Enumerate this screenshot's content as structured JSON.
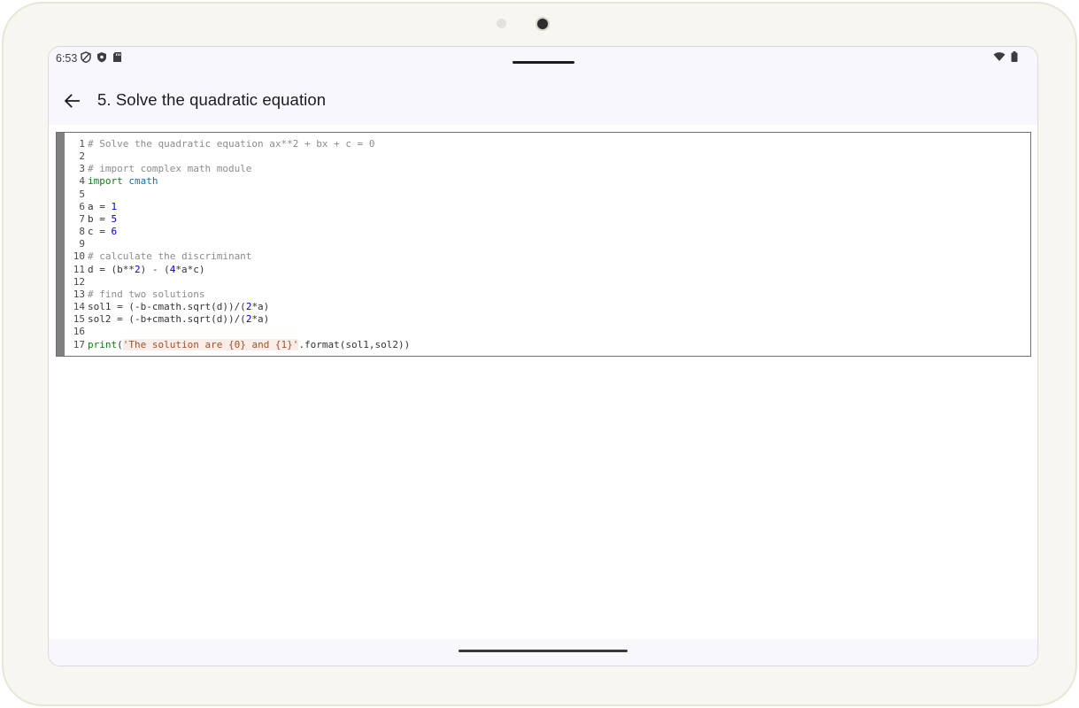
{
  "status_bar": {
    "time": "6:53",
    "left_icons": [
      "vpn-shield-icon",
      "privacy-shield-icon",
      "sd-card-icon"
    ],
    "right_icons": [
      "wifi-icon",
      "battery-icon"
    ]
  },
  "app_bar": {
    "back_icon": "arrow-left-icon",
    "title": "5. Solve the quadratic equation"
  },
  "code": {
    "lines": [
      {
        "n": "1",
        "tokens": [
          {
            "t": "# Solve the quadratic equation ax**2 + bx + c = 0",
            "c": "cm"
          }
        ]
      },
      {
        "n": "2",
        "tokens": []
      },
      {
        "n": "3",
        "tokens": [
          {
            "t": "# import complex math module",
            "c": "cm"
          }
        ]
      },
      {
        "n": "4",
        "tokens": [
          {
            "t": "import",
            "c": "kw"
          },
          {
            "t": " ",
            "c": ""
          },
          {
            "t": "cmath",
            "c": "fn"
          }
        ]
      },
      {
        "n": "5",
        "tokens": []
      },
      {
        "n": "6",
        "tokens": [
          {
            "t": "a = ",
            "c": ""
          },
          {
            "t": "1",
            "c": "num"
          }
        ]
      },
      {
        "n": "7",
        "tokens": [
          {
            "t": "b = ",
            "c": ""
          },
          {
            "t": "5",
            "c": "num"
          }
        ]
      },
      {
        "n": "8",
        "tokens": [
          {
            "t": "c = ",
            "c": ""
          },
          {
            "t": "6",
            "c": "num"
          }
        ]
      },
      {
        "n": "9",
        "tokens": []
      },
      {
        "n": "10",
        "tokens": [
          {
            "t": "# calculate the discriminant",
            "c": "cm"
          }
        ]
      },
      {
        "n": "11",
        "tokens": [
          {
            "t": "d = (b**",
            "c": ""
          },
          {
            "t": "2",
            "c": "num"
          },
          {
            "t": ") - (",
            "c": ""
          },
          {
            "t": "4",
            "c": "num"
          },
          {
            "t": "*a*c)",
            "c": ""
          }
        ]
      },
      {
        "n": "12",
        "tokens": []
      },
      {
        "n": "13",
        "tokens": [
          {
            "t": "# find two solutions",
            "c": "cm"
          }
        ]
      },
      {
        "n": "14",
        "tokens": [
          {
            "t": "sol1 = (-b-cmath.sqrt(d))/(",
            "c": ""
          },
          {
            "t": "2",
            "c": "num"
          },
          {
            "t": "*a)",
            "c": ""
          }
        ]
      },
      {
        "n": "15",
        "tokens": [
          {
            "t": "sol2 = (-b+cmath.sqrt(d))/(",
            "c": ""
          },
          {
            "t": "2",
            "c": "num"
          },
          {
            "t": "*a)",
            "c": ""
          }
        ]
      },
      {
        "n": "16",
        "tokens": []
      },
      {
        "n": "17",
        "tokens": [
          {
            "t": "print",
            "c": "kw"
          },
          {
            "t": "(",
            "c": ""
          },
          {
            "t": "'The solution are {0} and {1}'",
            "c": "str"
          },
          {
            "t": ".format(sol1,sol2))",
            "c": ""
          }
        ]
      }
    ]
  },
  "colors": {
    "comment": "#8c8c8c",
    "keyword": "#117a11",
    "module": "#1a6fa6",
    "number": "#0000cc",
    "string": "#a0522d",
    "gutter_stripe": "#808080"
  }
}
